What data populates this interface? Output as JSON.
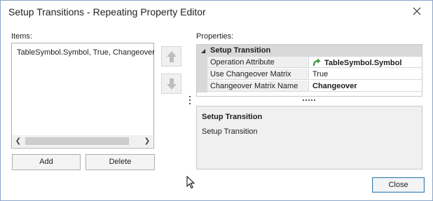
{
  "window": {
    "title": "Setup Transitions - Repeating Property Editor"
  },
  "items_panel": {
    "label": "Items:",
    "items": [
      "TableSymbol.Symbol, True, Changeover"
    ],
    "add_label": "Add",
    "delete_label": "Delete"
  },
  "properties_panel": {
    "label": "Properties:",
    "category": "Setup Transition",
    "rows": [
      {
        "name": "Operation Attribute",
        "value": "TableSymbol.Symbol",
        "icon": "green-curved-arrow-icon"
      },
      {
        "name": "Use Changeover Matrix",
        "value": "True"
      },
      {
        "name": "Changeover Matrix Name",
        "value": "Changeover"
      }
    ],
    "help_title": "Setup Transition",
    "help_description": "Setup Transition"
  },
  "footer": {
    "close_label": "Close"
  },
  "colors": {
    "category_bg": "#d9d9d9",
    "name_cell_bg": "#f0f0f0",
    "arrow_icon_green": "#3a9a3a",
    "window_border": "#8aa6c8"
  }
}
